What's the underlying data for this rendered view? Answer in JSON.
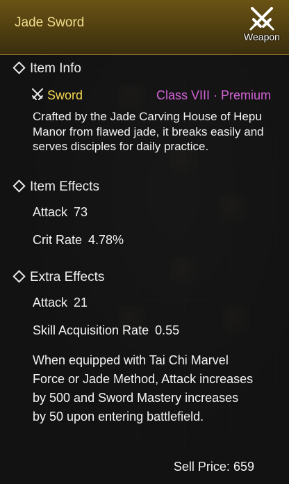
{
  "item": {
    "name": "Jade Sword",
    "type_badge": "Weapon",
    "weapon_type": "Sword",
    "grade": "Class VIII · Premium",
    "description": "Crafted by the Jade Carving House of Hepu Manor from flawed jade, it breaks easily and serves disciples for daily practice."
  },
  "sections": {
    "info": "Item Info",
    "effects": "Item Effects",
    "extra": "Extra Effects"
  },
  "item_effects": [
    {
      "label": "Attack",
      "value": "73"
    },
    {
      "label": "Crit Rate",
      "value": "4.78%"
    }
  ],
  "extra_effects": [
    {
      "label": "Attack",
      "value": "21"
    },
    {
      "label": "Skill Acquisition Rate",
      "value": "0.55"
    }
  ],
  "extra_description": "When equipped with Tai Chi Marvel Force or Jade Method, Attack increases by 500 and Sword Mastery increases by 50 upon entering battlefield.",
  "sell": {
    "label": "Sell Price:",
    "value": "659"
  },
  "colors": {
    "title": "#f1dd8c",
    "weapon_type": "#f2d64e",
    "grade": "#d462d8",
    "header": "#5a4712"
  }
}
